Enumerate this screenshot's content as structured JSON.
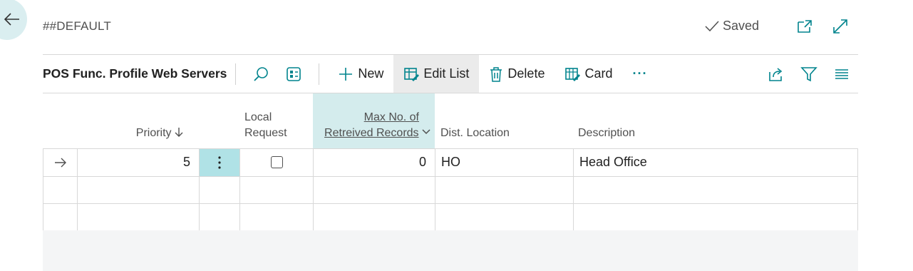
{
  "page": {
    "title": "##DEFAULT",
    "saved_label": "Saved"
  },
  "actionbar": {
    "list_name": "POS Func. Profile Web Servers",
    "new_label": "New",
    "edit_list_label": "Edit List",
    "delete_label": "Delete",
    "card_label": "Card",
    "more_label": "···"
  },
  "grid": {
    "columns": {
      "priority": "Priority",
      "local_request_1": "Local",
      "local_request_2": "Request",
      "max_records_1": "Max No. of",
      "max_records_2": "Retreived Records",
      "dist_location": "Dist. Location",
      "description": "Description"
    },
    "rows": [
      {
        "priority": "5",
        "local_request": false,
        "max_records": "0",
        "dist_location": "HO",
        "description": "Head Office"
      },
      {
        "priority": "",
        "local_request": null,
        "max_records": "",
        "dist_location": "",
        "description": ""
      },
      {
        "priority": "",
        "local_request": null,
        "max_records": "",
        "dist_location": "",
        "description": ""
      }
    ]
  },
  "colors": {
    "accent": "#00848d",
    "selected_column": "#d4eced",
    "selected_cell": "#b0e2e6",
    "back_circle": "#daeef0"
  }
}
